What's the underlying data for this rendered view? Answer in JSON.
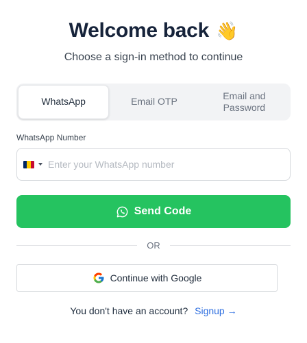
{
  "header": {
    "title": "Welcome back",
    "wave_emoji": "👋",
    "subtitle": "Choose a sign-in method to continue"
  },
  "tabs": [
    {
      "label": "WhatsApp",
      "active": true
    },
    {
      "label_line1": "Email OTP",
      "active": false
    },
    {
      "label_line1": "Email and",
      "label_line2": "Password",
      "active": false
    }
  ],
  "form": {
    "field_label": "WhatsApp Number",
    "phone_placeholder": "Enter your WhatsApp number",
    "phone_value": "",
    "country_flag": "flag-icon-chad",
    "send_label": "Send Code"
  },
  "divider": {
    "text": "OR"
  },
  "google": {
    "label": "Continue with Google"
  },
  "footer": {
    "prompt": "You don't have an account?",
    "link": "Signup →"
  },
  "colors": {
    "accent_green": "#25c360",
    "link_blue": "#2f6fe0",
    "title": "#16233a"
  }
}
